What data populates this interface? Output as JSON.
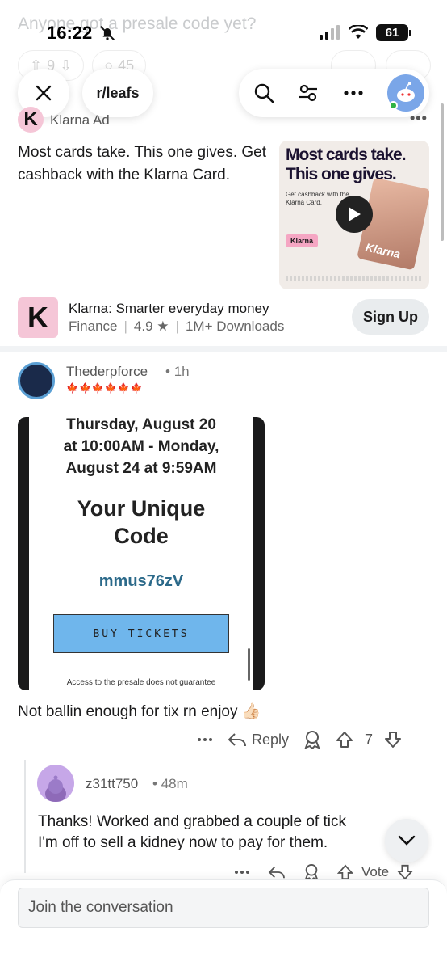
{
  "status": {
    "time": "16:22",
    "battery": "61"
  },
  "background_post": {
    "title": "Anyone got a presale code yet?",
    "upvotes": "9",
    "comments": "45"
  },
  "topbar": {
    "subreddit": "r/leafs"
  },
  "ad": {
    "advertiser": "Klarna",
    "ad_label": "Ad",
    "text": "Most cards take. This one gives. Get cashback with the Klarna Card.",
    "image_headline_1": "Most cards take.",
    "image_headline_2": "This one gives.",
    "image_sub": "Get cashback with the Klarna Card.",
    "image_brand": "Klarna",
    "card_brand": "Klarna",
    "app_icon_letter": "K",
    "app_name": "Klarna: Smarter everyday money",
    "app_category": "Finance",
    "app_rating": "4.9",
    "app_downloads": "1M+ Downloads",
    "cta": "Sign Up"
  },
  "comment": {
    "username": "Thederpforce",
    "time": "1h",
    "flair": "🍁🍁🍁🍁🍁🍁",
    "screenshot": {
      "dates_line1": "Thursday, August 20",
      "dates_line2": "at 10:00AM - Monday,",
      "dates_line3": "August 24 at 9:59AM",
      "heading_line1": "Your Unique",
      "heading_line2": "Code",
      "code": "mmus76zV",
      "button": "BUY TICKETS",
      "footer": "Access to the presale does not guarantee"
    },
    "body": "Not ballin enough for tix rn enjoy 👍🏻",
    "reply_label": "Reply",
    "votes": "7"
  },
  "reply": {
    "username": "z31tt750",
    "time": "48m",
    "body_line1": "Thanks! Worked and grabbed a couple of tick",
    "body_line2": "I'm off to sell a kidney now to pay for them.",
    "vote_label": "Vote"
  },
  "composer": {
    "placeholder": "Join the conversation"
  }
}
